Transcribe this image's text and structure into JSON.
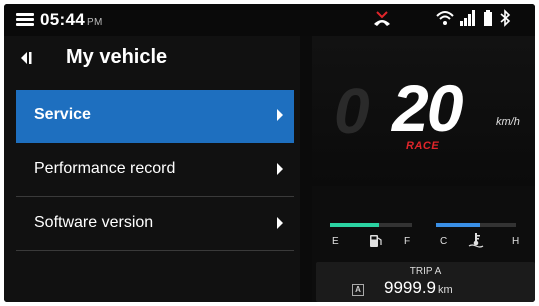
{
  "status_bar": {
    "time": "05:44",
    "ampm": "PM",
    "icons": [
      "menu-icon",
      "missed-call-icon",
      "wifi-icon",
      "signal-icon",
      "battery-icon",
      "bluetooth-icon"
    ]
  },
  "menu": {
    "title": "My vehicle",
    "items": [
      {
        "label": "Service",
        "selected": true
      },
      {
        "label": "Performance record",
        "selected": false
      },
      {
        "label": "Software version",
        "selected": false
      }
    ]
  },
  "dashboard": {
    "ghost_digit": "0",
    "speed": "20",
    "speed_unit": "km/h",
    "riding_mode": "RACE",
    "fuel": {
      "empty_label": "E",
      "full_label": "F",
      "level": 0.6
    },
    "temperature": {
      "cold_label": "C",
      "hot_label": "H",
      "level": 0.55
    },
    "trip": {
      "label": "TRIP A",
      "badge": "A",
      "value": "9999.9",
      "unit": "km"
    }
  },
  "colors": {
    "accent": "#1e6fbf",
    "fuel": "#2bd3a2",
    "temperature": "#3a8fe6",
    "mode": "#e0252a",
    "missed_call": "#e0252a"
  }
}
